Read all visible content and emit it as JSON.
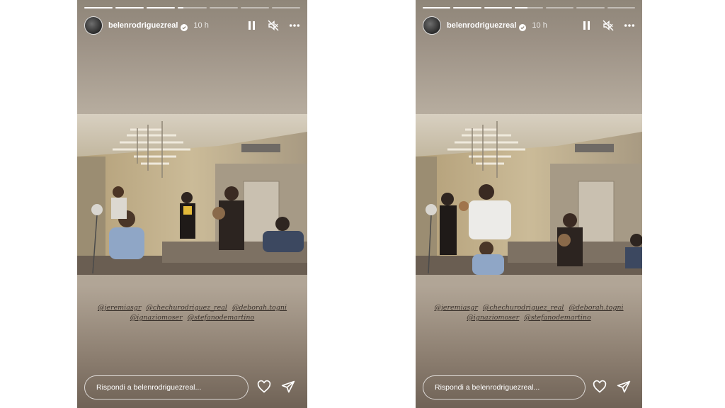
{
  "stories": [
    {
      "username": "belenrodriguezreal",
      "time": "10 h",
      "progress": {
        "segments": 7,
        "current_index": 3,
        "current_fill": 0.2
      },
      "mentions_line1": [
        "@jeremiasgr",
        "@chechurodriguez_real",
        "@deborah.togni"
      ],
      "mentions_line2": [
        "@ignaziomoser",
        "@stefanodemartino"
      ],
      "reply_placeholder": "Rispondi a belenrodriguezreal..."
    },
    {
      "username": "belenrodriguezreal",
      "time": "10 h",
      "progress": {
        "segments": 7,
        "current_index": 3,
        "current_fill": 0.45
      },
      "mentions_line1": [
        "@jeremiasgr",
        "@chechurodriguez_real",
        "@deborah.togni"
      ],
      "mentions_line2": [
        "@ignaziomoser",
        "@stefanodemartino"
      ],
      "reply_placeholder": "Rispondi a belenrodriguezreal..."
    }
  ],
  "icons": {
    "pause": "pause-icon",
    "mute": "speaker-muted-icon",
    "more": "more-options-icon",
    "like": "heart-icon",
    "share": "paper-plane-icon",
    "verified": "verified-badge-icon"
  },
  "colors": {
    "text": "#ffffff",
    "mention": "#3b332d",
    "verified": "#ffffff"
  }
}
